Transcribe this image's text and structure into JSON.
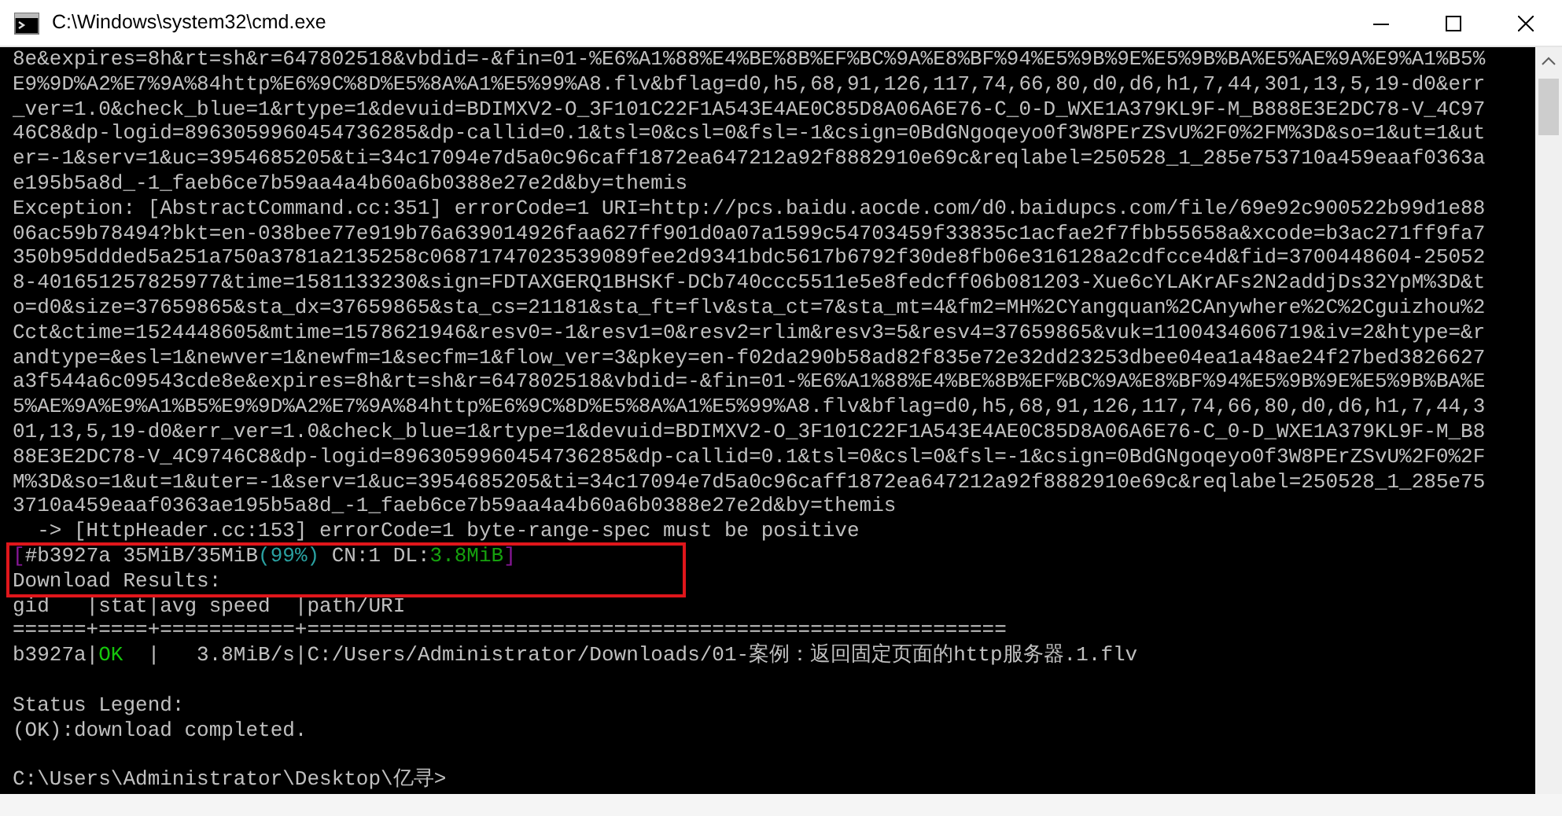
{
  "window": {
    "title": "C:\\Windows\\system32\\cmd.exe"
  },
  "console": {
    "lines": [
      {
        "kind": "plain",
        "text": "8e&expires=8h&rt=sh&r=647802518&vbdid=-&fin=01-%E6%A1%88%E4%BE%8B%EF%BC%9A%E8%BF%94%E5%9B%9E%E5%9B%BA%E5%AE%9A%E9%A1%B5%"
      },
      {
        "kind": "plain",
        "text": "E9%9D%A2%E7%9A%84http%E6%9C%8D%E5%8A%A1%E5%99%A8.flv&bflag=d0,h5,68,91,126,117,74,66,80,d0,d6,h1,7,44,301,13,5,19-d0&err"
      },
      {
        "kind": "plain",
        "text": "_ver=1.0&check_blue=1&rtype=1&devuid=BDIMXV2-O_3F101C22F1A543E4AE0C85D8A06A6E76-C_0-D_WXE1A379KL9F-M_B888E3E2DC78-V_4C97"
      },
      {
        "kind": "plain",
        "text": "46C8&dp-logid=8963059960454736285&dp-callid=0.1&tsl=0&csl=0&fsl=-1&csign=0BdGNgoqeyo0f3W8PErZSvU%2F0%2FM%3D&so=1&ut=1&ut"
      },
      {
        "kind": "plain",
        "text": "er=-1&serv=1&uc=3954685205&ti=34c17094e7d5a0c96caff1872ea647212a92f8882910e69c&reqlabel=250528_1_285e753710a459eaaf0363a"
      },
      {
        "kind": "plain",
        "text": "e195b5a8d_-1_faeb6ce7b59aa4a4b60a6b0388e27e2d&by=themis"
      },
      {
        "kind": "plain",
        "text": "Exception: [AbstractCommand.cc:351] errorCode=1 URI=http://pcs.baidu.aocde.com/d0.baidupcs.com/file/69e92c900522b99d1e88"
      },
      {
        "kind": "plain",
        "text": "06ac59b78494?bkt=en-038bee77e919b76a639014926faa627ff901d0a07a1599c54703459f33835c1acfae2f7fbb55658a&xcode=b3ac271ff9fa7"
      },
      {
        "kind": "plain",
        "text": "350b95ddded5a251a750a3781a2135258c06871747023539089fee2d9341bdc5617b6792f30de8fb06e316128a2cdfcce4d&fid=3700448604-25052"
      },
      {
        "kind": "plain",
        "text": "8-401651257825977&time=1581133230&sign=FDTAXGERQ1BHSKf-DCb740ccc5511e5e8fedcff06b081203-Xue6cYLAKrAFs2N2addjDs32YpM%3D&t"
      },
      {
        "kind": "plain",
        "text": "o=d0&size=37659865&sta_dx=37659865&sta_cs=21181&sta_ft=flv&sta_ct=7&sta_mt=4&fm2=MH%2CYangquan%2CAnywhere%2C%2Cguizhou%2"
      },
      {
        "kind": "plain",
        "text": "Cct&ctime=1524448605&mtime=1578621946&resv0=-1&resv1=0&resv2=rlim&resv3=5&resv4=37659865&vuk=1100434606719&iv=2&htype=&r"
      },
      {
        "kind": "plain",
        "text": "andtype=&esl=1&newver=1&newfm=1&secfm=1&flow_ver=3&pkey=en-f02da290b58ad82f835e72e32dd23253dbee04ea1a48ae24f27bed3826627"
      },
      {
        "kind": "plain",
        "text": "a3f544a6c09543cde8e&expires=8h&rt=sh&r=647802518&vbdid=-&fin=01-%E6%A1%88%E4%BE%8B%EF%BC%9A%E8%BF%94%E5%9B%9E%E5%9B%BA%E"
      },
      {
        "kind": "plain",
        "text": "5%AE%9A%E9%A1%B5%E9%9D%A2%E7%9A%84http%E6%9C%8D%E5%8A%A1%E5%99%A8.flv&bflag=d0,h5,68,91,126,117,74,66,80,d0,d6,h1,7,44,3"
      },
      {
        "kind": "plain",
        "text": "01,13,5,19-d0&err_ver=1.0&check_blue=1&rtype=1&devuid=BDIMXV2-O_3F101C22F1A543E4AE0C85D8A06A6E76-C_0-D_WXE1A379KL9F-M_B8"
      },
      {
        "kind": "plain",
        "text": "88E3E2DC78-V_4C9746C8&dp-logid=8963059960454736285&dp-callid=0.1&tsl=0&csl=0&fsl=-1&csign=0BdGNgoqeyo0f3W8PErZSvU%2F0%2F"
      },
      {
        "kind": "plain",
        "text": "M%3D&so=1&ut=1&uter=-1&serv=1&uc=3954685205&ti=34c17094e7d5a0c96caff1872ea647212a92f8882910e69c&reqlabel=250528_1_285e75"
      },
      {
        "kind": "plain",
        "text": "3710a459eaaf0363ae195b5a8d_-1_faeb6ce7b59aa4a4b60a6b0388e27e2d&by=themis"
      },
      {
        "kind": "plain",
        "text": "  -> [HttpHeader.cc:153] errorCode=1 byte-range-spec must be positive"
      },
      {
        "kind": "colored",
        "segments": [
          {
            "text": "[",
            "color": "#881798"
          },
          {
            "text": "#b3927a 35MiB/35MiB"
          },
          {
            "text": "(99%)",
            "color": "#2aa1a1"
          },
          {
            "text": " CN:1 DL:"
          },
          {
            "text": "3.8MiB",
            "color": "#16a10e"
          },
          {
            "text": "]",
            "color": "#881798"
          }
        ]
      },
      {
        "kind": "plain",
        "text": "Download Results:"
      },
      {
        "kind": "plain",
        "text": "gid   |stat|avg speed  |path/URI"
      },
      {
        "kind": "plain",
        "text": "======+====+===========+========================================================="
      },
      {
        "kind": "colored",
        "segments": [
          {
            "text": "b3927a|"
          },
          {
            "text": "OK",
            "color": "#16c60c"
          },
          {
            "text": "  |   3.8MiB/s|C:/Users/Administrator/Downloads/01-案例：返回固定页面的http服务器.1.flv"
          }
        ]
      },
      {
        "kind": "blank"
      },
      {
        "kind": "plain",
        "text": "Status Legend:"
      },
      {
        "kind": "plain",
        "text": "(OK):download completed."
      },
      {
        "kind": "blank"
      },
      {
        "kind": "plain",
        "text": "C:\\Users\\Administrator\\Desktop\\亿寻>"
      }
    ]
  }
}
